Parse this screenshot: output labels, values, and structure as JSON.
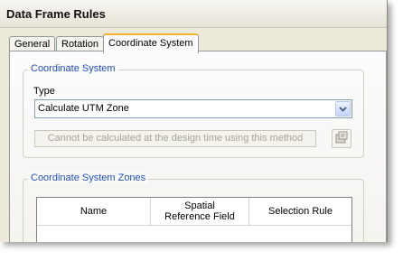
{
  "window": {
    "title": "Data Frame Rules"
  },
  "tabs": [
    {
      "label": "General"
    },
    {
      "label": "Rotation"
    },
    {
      "label": "Coordinate System"
    }
  ],
  "coordinate_system": {
    "group_label": "Coordinate System",
    "type_label": "Type",
    "type_value": "Calculate UTM Zone",
    "disabled_button_label": "Cannot be calculated at the design time using this method"
  },
  "zones": {
    "group_label": "Coordinate System Zones",
    "columns": [
      "Name",
      "Spatial\nReference Field",
      "Selection Rule"
    ]
  },
  "icons": {
    "dropdown": "chevron-down-icon",
    "properties": "properties-icon"
  }
}
